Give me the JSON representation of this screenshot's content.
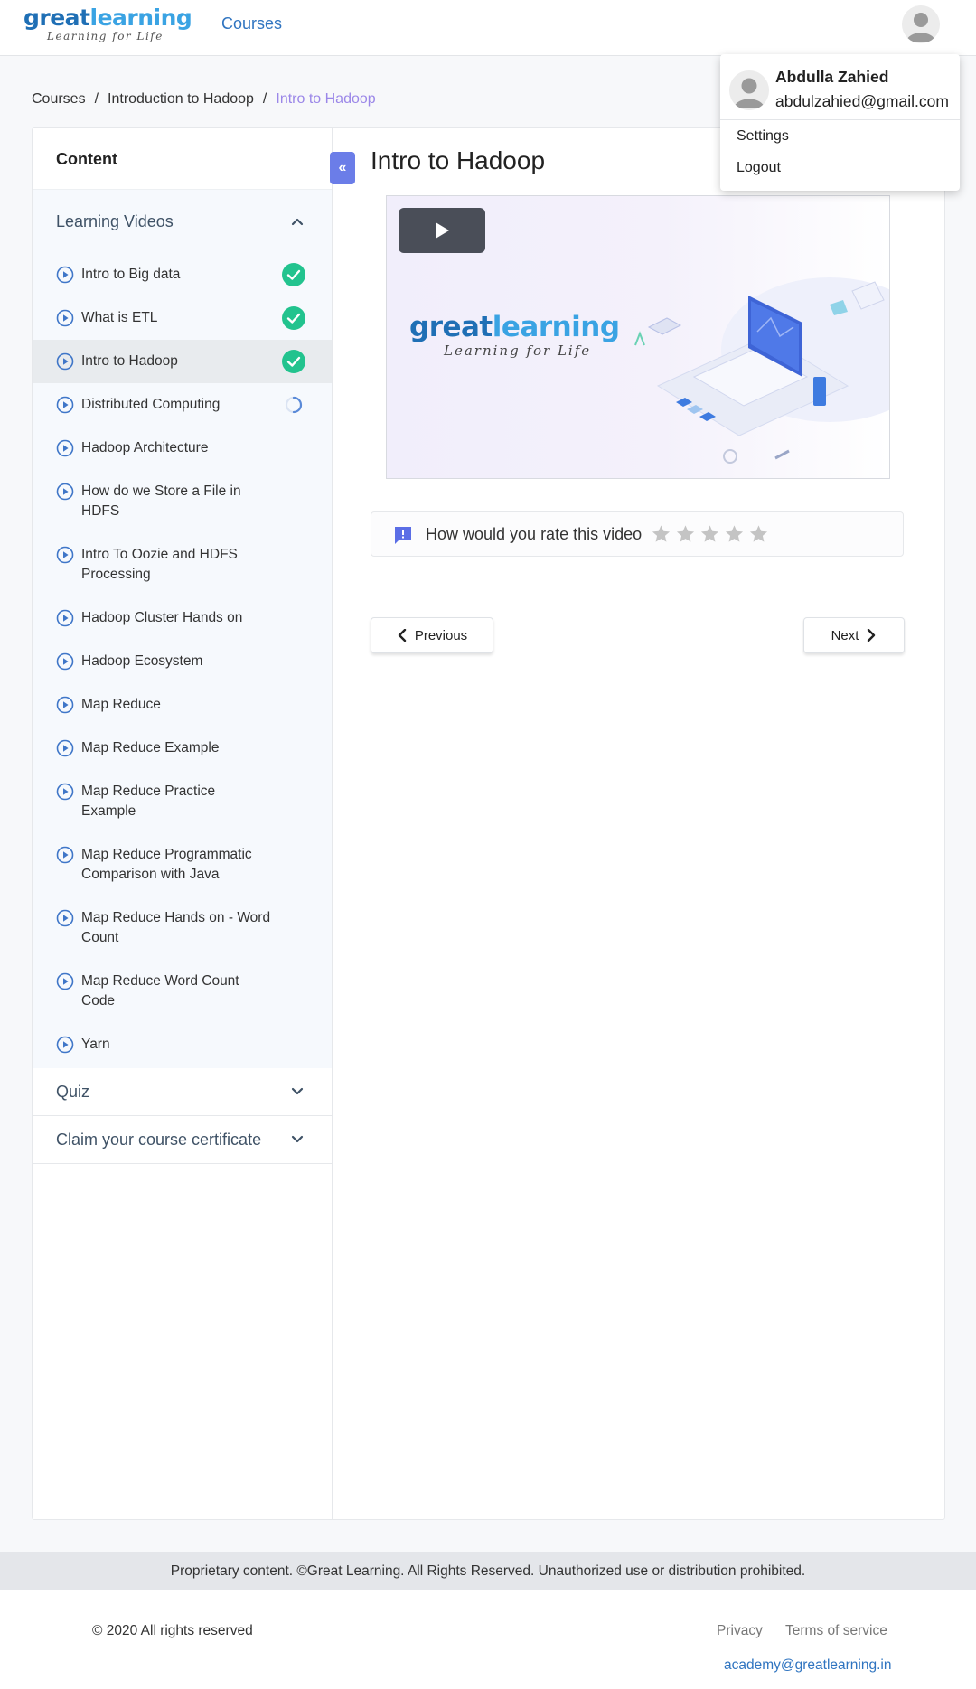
{
  "header": {
    "logo": {
      "main_a": "great",
      "main_b": "learning",
      "tagline": "Learning for Life"
    },
    "nav_courses": "Courses"
  },
  "breadcrumb": {
    "items": [
      "Courses",
      "Introduction to Hadoop"
    ],
    "current": "Intro to Hadoop",
    "separator": "/"
  },
  "sidebar": {
    "title": "Content",
    "sections": {
      "videos": "Learning Videos",
      "quiz": "Quiz",
      "certificate": "Claim your course certificate"
    },
    "videos": [
      {
        "label": "Intro to Big data",
        "status": "completed"
      },
      {
        "label": "What is ETL",
        "status": "completed"
      },
      {
        "label": "Intro to Hadoop",
        "status": "completed",
        "active": true
      },
      {
        "label": "Distributed Computing",
        "status": "in-progress"
      },
      {
        "label": "Hadoop Architecture",
        "status": "none"
      },
      {
        "label": "How do we Store a File in HDFS",
        "status": "none"
      },
      {
        "label": "Intro To Oozie and HDFS Processing",
        "status": "none"
      },
      {
        "label": "Hadoop Cluster Hands on",
        "status": "none"
      },
      {
        "label": "Hadoop Ecosystem",
        "status": "none"
      },
      {
        "label": "Map Reduce",
        "status": "none"
      },
      {
        "label": "Map Reduce Example",
        "status": "none"
      },
      {
        "label": "Map Reduce Practice Example",
        "status": "none"
      },
      {
        "label": "Map Reduce Programmatic Comparison with Java",
        "status": "none"
      },
      {
        "label": "Map Reduce Hands on - Word Count",
        "status": "none"
      },
      {
        "label": "Map Reduce Word Count Code",
        "status": "none"
      },
      {
        "label": "Yarn",
        "status": "none"
      }
    ]
  },
  "content": {
    "title": "Intro to Hadoop",
    "video_logo": {
      "main_a": "great",
      "main_b": "learning",
      "tagline": "Learning for Life"
    },
    "rating_prompt": "How would you rate this video",
    "rating_value": 0,
    "rating_max": 5,
    "prev_label": "Previous",
    "next_label": "Next"
  },
  "footer": {
    "proprietary": "Proprietary content. ©Great Learning. All Rights Reserved. Unauthorized use or distribution prohibited.",
    "copyright": "© 2020 All rights reserved",
    "privacy": "Privacy",
    "terms": "Terms of service",
    "email": "academy@greatlearning.in"
  },
  "user_menu": {
    "name": "Abdulla Zahied",
    "email": "abdulzahied@gmail.com",
    "settings": "Settings",
    "logout": "Logout"
  },
  "icons": {
    "play": "play-circle-icon",
    "check": "check-circle-icon",
    "loading": "spinner-icon",
    "chevron_up": "chevron-up-icon",
    "chevron_down": "chevron-down-icon",
    "star": "star-icon",
    "feedback": "feedback-icon"
  },
  "colors": {
    "brand_blue": "#1f6fb5",
    "accent_purple": "#6b7de8",
    "success_green": "#22c38e",
    "link_blue": "#2f74c0",
    "star_gray": "#c4c4c4"
  }
}
